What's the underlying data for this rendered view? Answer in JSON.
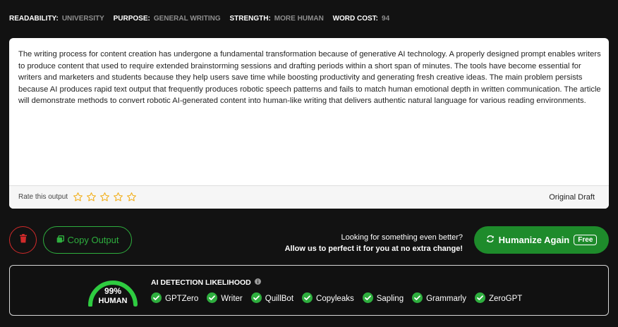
{
  "meta": [
    {
      "key": "READABILITY:",
      "value": "UNIVERSITY"
    },
    {
      "key": "PURPOSE:",
      "value": "GENERAL WRITING"
    },
    {
      "key": "STRENGTH:",
      "value": "MORE HUMAN"
    },
    {
      "key": "WORD COST:",
      "value": "94"
    }
  ],
  "output": {
    "text": "The writing process for content creation has undergone a fundamental transformation because of generative AI technology. A properly designed prompt enables writers to produce content that used to require extended brainstorming sessions and drafting periods within a short span of minutes. The tools have become essential for writers and marketers and students because they help users save time while boosting productivity and generating fresh creative ideas. The main problem persists because AI produces rapid text output that frequently produces robotic speech patterns and fails to match human emotional depth in written communication. The article will demonstrate methods to convert robotic AI-generated content into human-like writing that delivers authentic natural language for various reading environments.",
    "rate_label": "Rate this output",
    "rating": 0,
    "star_count": 5,
    "draft_label": "Original Draft"
  },
  "actions": {
    "copy_label": "Copy Output",
    "promo_line1": "Looking for something even better?",
    "promo_line2": "Allow us to perfect it for you at no extra change!",
    "humanize_label": "Humanize Again",
    "free_badge": "Free"
  },
  "detection": {
    "title": "AI DETECTION LIKELIHOOD",
    "human_percent": "99%",
    "human_fraction": 0.99,
    "human_label": "HUMAN",
    "detectors": [
      "GPTZero",
      "Writer",
      "QuillBot",
      "Copyleaks",
      "Sapling",
      "Grammarly",
      "ZeroGPT"
    ]
  },
  "colors": {
    "accent_green": "#1e8b2b",
    "check_green": "#2eae3e",
    "delete_red": "#d02a2a",
    "star_yellow": "#f2b01e"
  }
}
